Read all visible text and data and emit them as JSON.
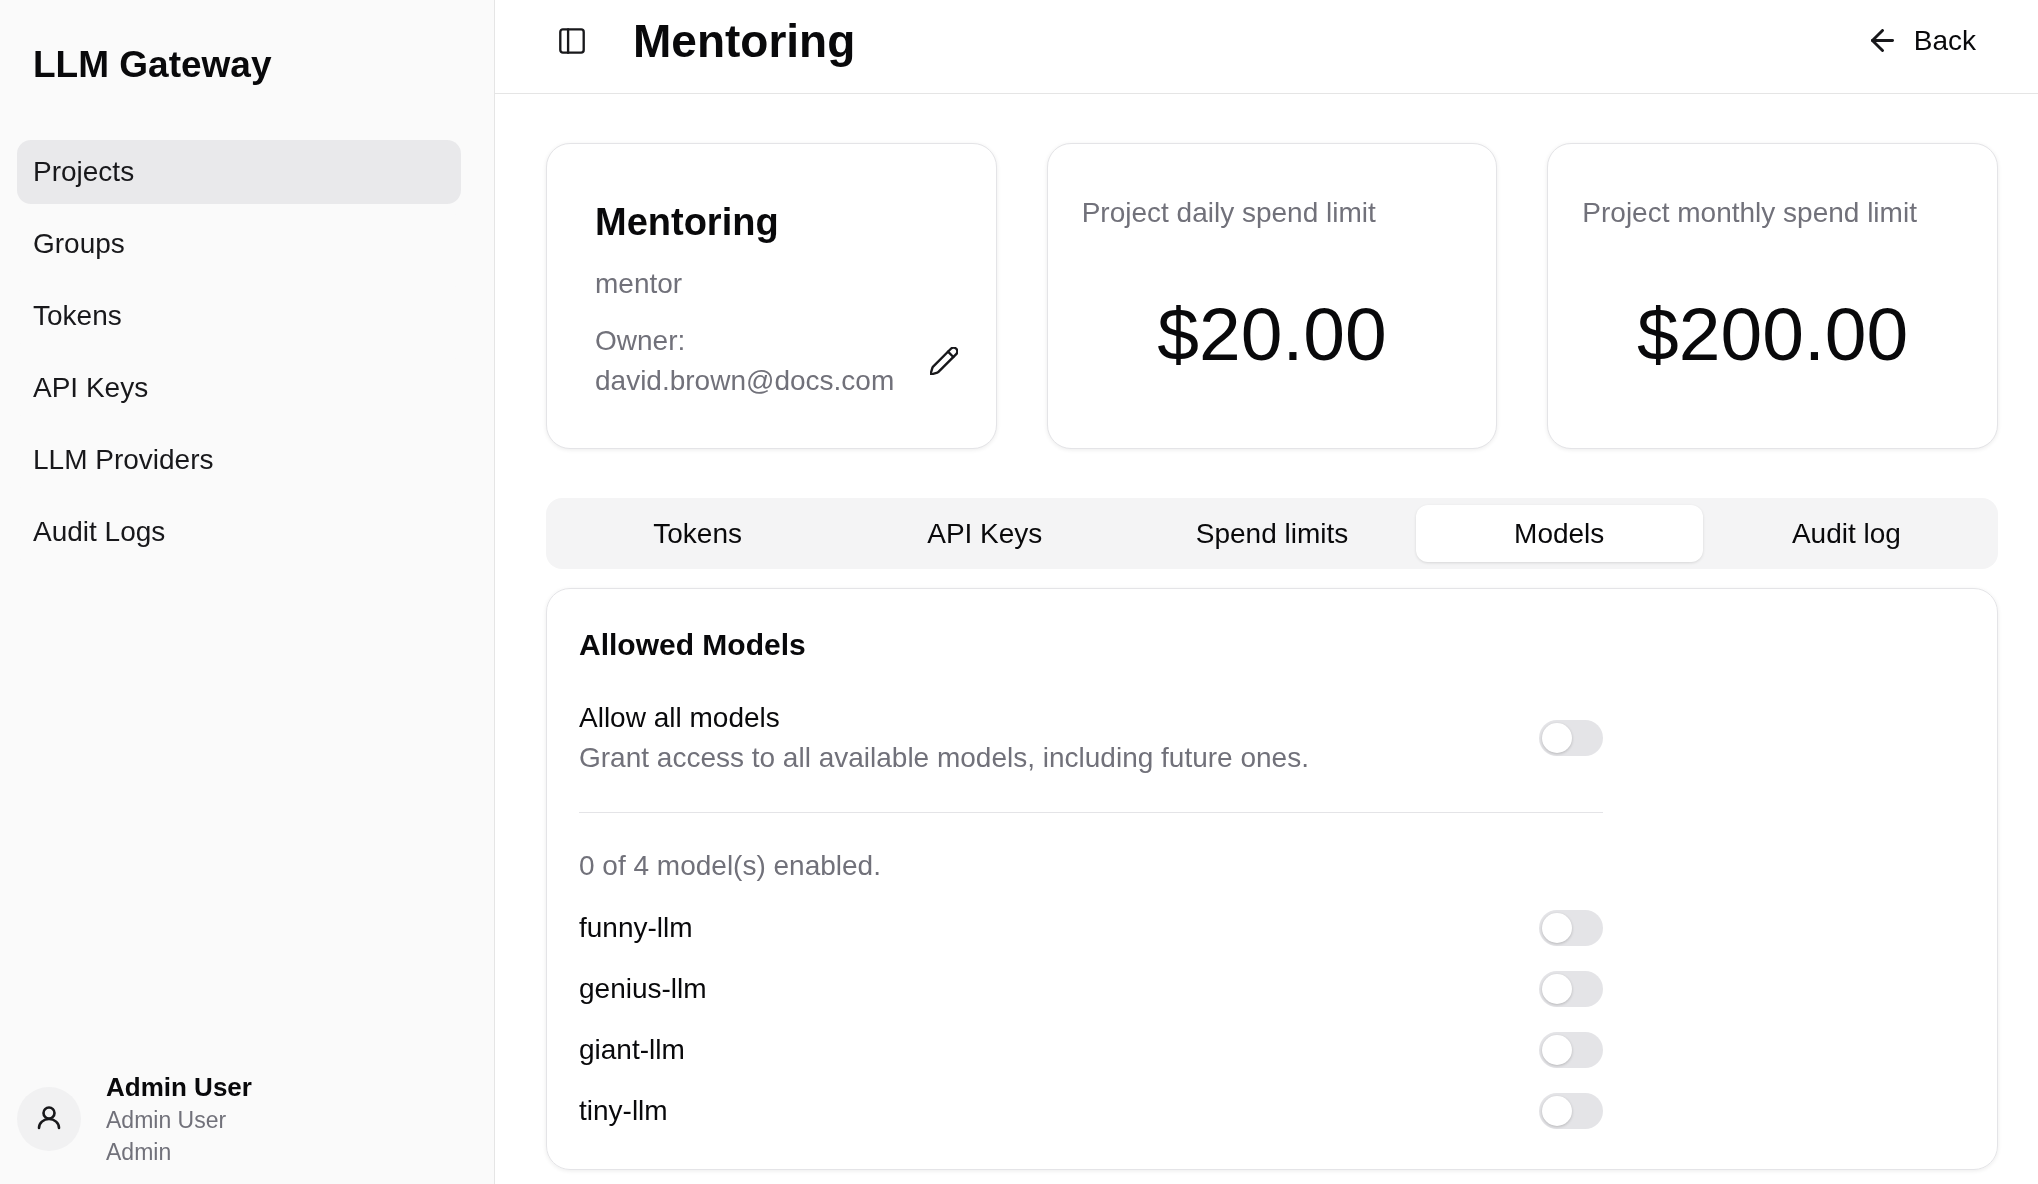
{
  "sidebar": {
    "app_title": "LLM Gateway",
    "items": [
      {
        "label": "Projects",
        "selected": true
      },
      {
        "label": "Groups",
        "selected": false
      },
      {
        "label": "Tokens",
        "selected": false
      },
      {
        "label": "API Keys",
        "selected": false
      },
      {
        "label": "LLM Providers",
        "selected": false
      },
      {
        "label": "Audit Logs",
        "selected": false
      }
    ],
    "user": {
      "name": "Admin User",
      "display_name": "Admin User",
      "role": "Admin"
    }
  },
  "header": {
    "title": "Mentoring",
    "back_label": "Back"
  },
  "project_card": {
    "name": "Mentoring",
    "slug": "mentor",
    "owner": "Owner: david.brown@docs.com"
  },
  "limit_cards": [
    {
      "label": "Project daily spend limit",
      "value": "$20.00"
    },
    {
      "label": "Project monthly spend limit",
      "value": "$200.00"
    }
  ],
  "tabs": [
    {
      "label": "Tokens",
      "selected": false
    },
    {
      "label": "API Keys",
      "selected": false
    },
    {
      "label": "Spend limits",
      "selected": false
    },
    {
      "label": "Models",
      "selected": true
    },
    {
      "label": "Audit log",
      "selected": false
    }
  ],
  "models_panel": {
    "title": "Allowed Models",
    "allow_all": {
      "label": "Allow all models",
      "description": "Grant access to all available models, including future ones.",
      "on": false
    },
    "summary": "0 of 4 model(s) enabled.",
    "models": [
      {
        "name": "funny-llm",
        "on": false
      },
      {
        "name": "genius-llm",
        "on": false
      },
      {
        "name": "giant-llm",
        "on": false
      },
      {
        "name": "tiny-llm",
        "on": false
      }
    ]
  }
}
